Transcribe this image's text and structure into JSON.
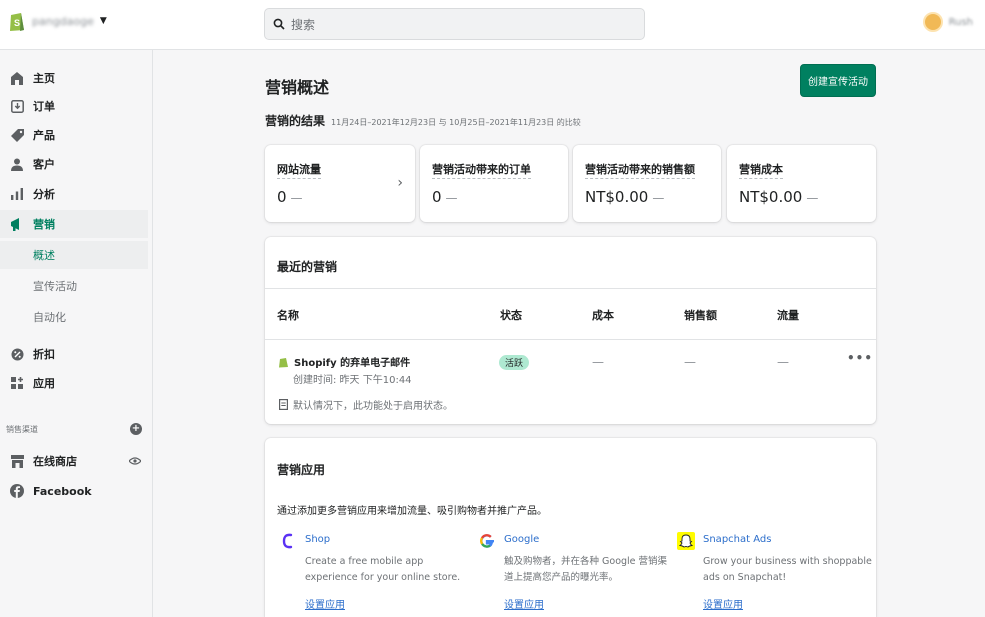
{
  "topbar": {
    "store_name": "pangdaoge",
    "search_placeholder": "搜索",
    "user_name": "Rush"
  },
  "sidebar": {
    "items": [
      {
        "label": "主页",
        "icon": "home-icon"
      },
      {
        "label": "订单",
        "icon": "orders-icon"
      },
      {
        "label": "产品",
        "icon": "tag-icon"
      },
      {
        "label": "客户",
        "icon": "person-icon"
      },
      {
        "label": "分析",
        "icon": "bar-chart-icon"
      },
      {
        "label": "营销",
        "icon": "megaphone-icon"
      }
    ],
    "sub_items": [
      "概述",
      "宣传活动",
      "自动化"
    ],
    "items2": [
      {
        "label": "折扣",
        "icon": "discount-icon"
      },
      {
        "label": "应用",
        "icon": "apps-icon"
      }
    ],
    "channels_label": "销售渠道",
    "channels": [
      {
        "label": "在线商店",
        "icon": "store-icon"
      },
      {
        "label": "Facebook",
        "icon": "facebook-icon"
      }
    ]
  },
  "main": {
    "title": "营销概述",
    "create_button": "创建宣传活动",
    "results_label": "营销的结果",
    "results_range": "11月24日–2021年12月23日 与 10月25日–2021年11月23日 的比较",
    "metrics": [
      {
        "label": "网站流量",
        "value": "0",
        "delta": "—"
      },
      {
        "label": "营销活动带来的订单",
        "value": "0",
        "delta": "—"
      },
      {
        "label": "营销活动带来的销售额",
        "value": "NT$0.00",
        "delta": "—"
      },
      {
        "label": "营销成本",
        "value": "NT$0.00",
        "delta": "—"
      }
    ],
    "recent": {
      "title": "最近的营销",
      "columns": [
        "名称",
        "状态",
        "成本",
        "销售额",
        "流量"
      ],
      "row": {
        "name": "Shopify 的弃单电子邮件",
        "created": "创建时间: 昨天 下午10:44",
        "status": "活跃",
        "cost": "—",
        "sales": "—",
        "traffic": "—",
        "note": "默认情况下，此功能处于启用状态。"
      }
    },
    "apps": {
      "title": "营销应用",
      "intro": "通过添加更多营销应用来增加流量、吸引购物者并推广产品。",
      "list": [
        {
          "name": "Shop",
          "desc": "Create a free mobile app experience for your online store.",
          "link": "设置应用",
          "icon": "shop-app-icon"
        },
        {
          "name": "Google",
          "desc": "触及购物者，并在各种 Google 营销渠道上提高您产品的曝光率。",
          "link": "设置应用",
          "icon": "google-icon"
        },
        {
          "name": "Snapchat Ads",
          "desc": "Grow your business with shoppable ads on Snapchat!",
          "link": "设置应用",
          "icon": "snapchat-icon"
        }
      ]
    }
  },
  "colors": {
    "accent": "#008060",
    "link": "#2c6ecb",
    "badge": "#aee9d1"
  }
}
